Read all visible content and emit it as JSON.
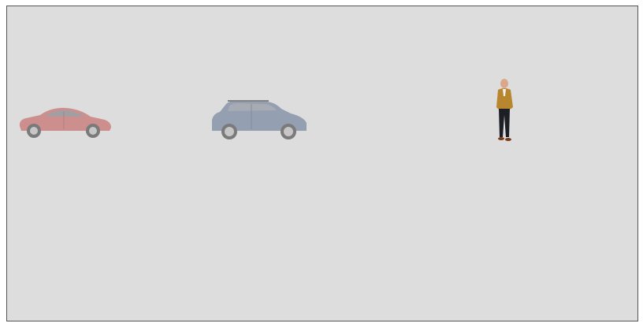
{
  "scene": {
    "background_color": "#dddddd",
    "border_color": "#555555",
    "objects": [
      {
        "name": "red-hatchback-car",
        "kind": "car",
        "color": "#c0504d",
        "faded": true
      },
      {
        "name": "blue-suv-car",
        "kind": "car",
        "color": "#5b6e8f",
        "faded": true
      },
      {
        "name": "standing-man",
        "kind": "person",
        "jacket_color": "#b8862f",
        "trousers_color": "#1c1f26"
      }
    ]
  }
}
